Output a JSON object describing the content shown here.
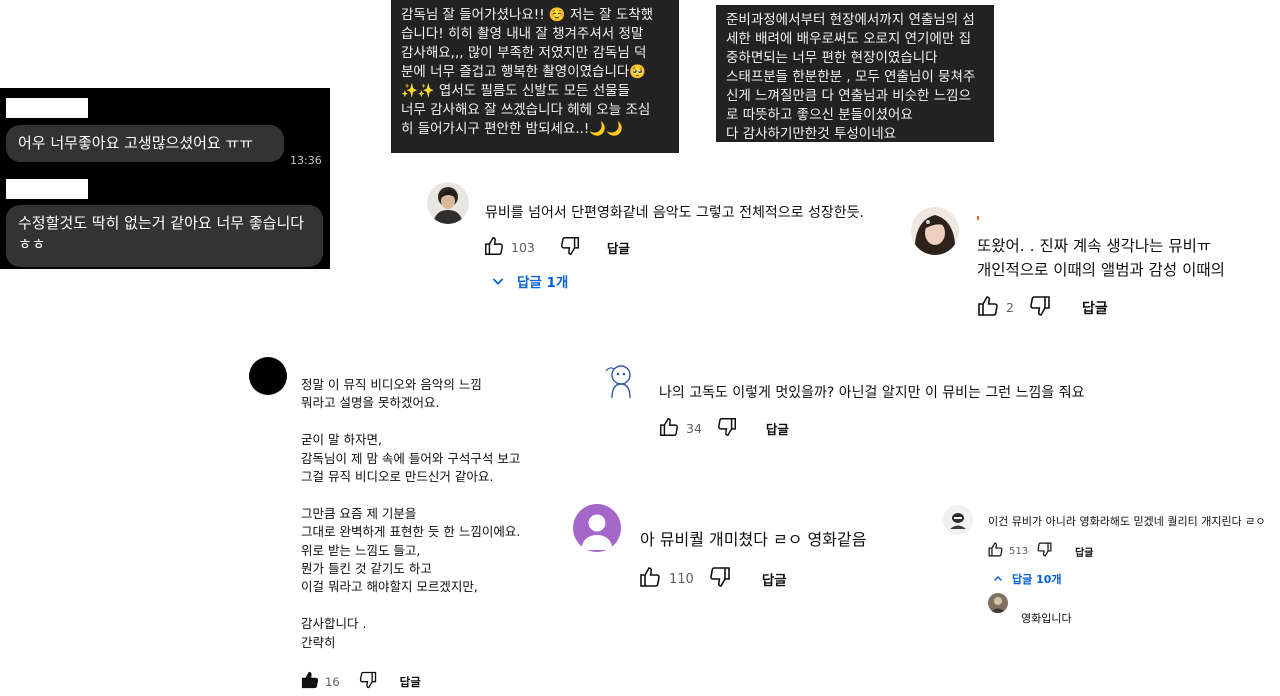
{
  "chat": {
    "messages": [
      {
        "text": "어우 너무좋아요 고생많으셨어요 ㅠㅠ",
        "time": "13:36"
      },
      {
        "text": "수정할것도 딱히 없는거 같아요 너무 좋습니다ㅎㅎ"
      }
    ]
  },
  "note_left": {
    "text": "감독님 잘 들어가셨나요!! ☺️ 저는 잘 도착했\n습니다! 히히 촬영 내내 잘 챙겨주셔서 정말\n감사해요,,, 많이 부족한 저였지만 감독님 덕\n분에 너무 즐겁고 행복한 촬영이였습니다🥺\n✨✨ 엽서도 필름도 신발도 모든 선물들\n너무 감사해요 잘 쓰겠습니다 헤헤 오늘 조심\n히 들어가시구 편안한 밤되세요..!🌙🌙"
  },
  "note_right": {
    "text": "준비과정에서부터 현장에서까지 연출님의 섬\n세한 배려에 배우로써도 오로지 연기에만 집\n중하면되는 너무 편한 현장이였습니다\n스태프분들 한분한분 , 모두 연출님이 뭉쳐주\n신게 느껴질만큼 다 연출님과 비슷한 느낌으\n로 따뜻하고 좋으신 분들이셨어요\n다 감사하기만한것 투성이네요"
  },
  "comments": [
    {
      "text": "뮤비를 넘어서 단편영화같네 음악도 그렇고 전체적으로 성장한듯.",
      "likes": "103",
      "reply": "답글",
      "replies": "답글 1개"
    },
    {
      "text": "또왔어. . 진짜 계속 생각나는 뮤비ㅠ\n개인적으로 이때의 앨범과 감성 이때의",
      "likes": "2",
      "reply": "답글"
    },
    {
      "text": "정말 이 뮤직 비디오와 음악의 느낌\n뭐라고 설명을 못하겠어요.\n\n굳이 말 하자면,\n감독님이 제 맘 속에 들어와 구석구석 보고\n그걸 뮤직 비디오로 만드신거 같아요.\n\n그만큼 요즘 제 기분을\n그대로 완벽하게 표현한 듯 한 느낌이에요.\n위로 받는 느낌도 들고,\n뭔가 들킨 것 같기도 하고\n이걸 뭐라고 해야할지 모르겠지만,\n\n감사합니다 .\n간략히",
      "likes": "16",
      "reply": "답글"
    },
    {
      "text": "나의 고독도 이렇게 멋있을까? 아닌걸 알지만 이 뮤비는 그런 느낌을 줘요",
      "likes": "34",
      "reply": "답글"
    },
    {
      "text": "아 뮤비퀄 개미쳤다 ㄹㅇ 영화같음",
      "likes": "110",
      "reply": "답글"
    },
    {
      "text": "이건 뮤비가 아니라 영화라해도 믿겠네 퀄리티 개지린다 ㄹㅇ",
      "likes": "513",
      "reply": "답글",
      "replies": "답글 10개",
      "sub_reply": "영화입니다"
    }
  ],
  "icons": {
    "like": "thumbs-up-icon",
    "dislike": "thumbs-down-icon",
    "expand": "chevron-down-icon",
    "collapse": "chevron-up-icon"
  },
  "colors": {
    "link": "#065fd4",
    "chat_bubble": "#333333",
    "avatar_purple": "#a566c9"
  }
}
